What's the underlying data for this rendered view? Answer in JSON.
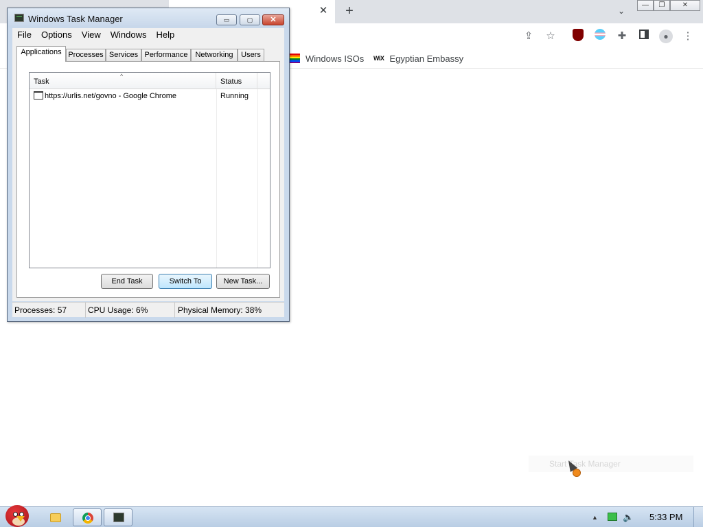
{
  "task_manager": {
    "title": "Windows Task Manager",
    "title_buttons": {
      "minimize": "▭",
      "maximize": "▢",
      "close": "✕"
    },
    "menu": [
      "File",
      "Options",
      "View",
      "Windows",
      "Help"
    ],
    "tabs": [
      "Applications",
      "Processes",
      "Services",
      "Performance",
      "Networking",
      "Users"
    ],
    "active_tab": "Applications",
    "columns": {
      "task": "Task",
      "status": "Status"
    },
    "rows": [
      {
        "task": "https://urlis.net/govno - Google Chrome",
        "status": "Running"
      }
    ],
    "buttons": {
      "end_task": "End Task",
      "switch_to": "Switch To",
      "new_task": "New Task..."
    },
    "status_bar": {
      "processes": "Processes: 57",
      "cpu": "CPU Usage: 6%",
      "memory": "Physical Memory: 38%"
    }
  },
  "browser": {
    "tab_close": "✕",
    "new_tab": "+",
    "tab_search": "⌄",
    "window_buttons": {
      "minimize": "—",
      "restore": "❐",
      "close": "✕"
    },
    "bookmarks": [
      {
        "label": "Windows ISOs",
        "icon": "rainbow-flag-icon"
      },
      {
        "label": "Egyptian Embassy",
        "icon": "wix-icon",
        "icon_text": "WiX"
      }
    ]
  },
  "tooltip_remnant": "Start Task Manager",
  "taskbar": {
    "clock": "5:33 PM",
    "tray_expand": "▲",
    "volume_glyph": "🔈"
  }
}
